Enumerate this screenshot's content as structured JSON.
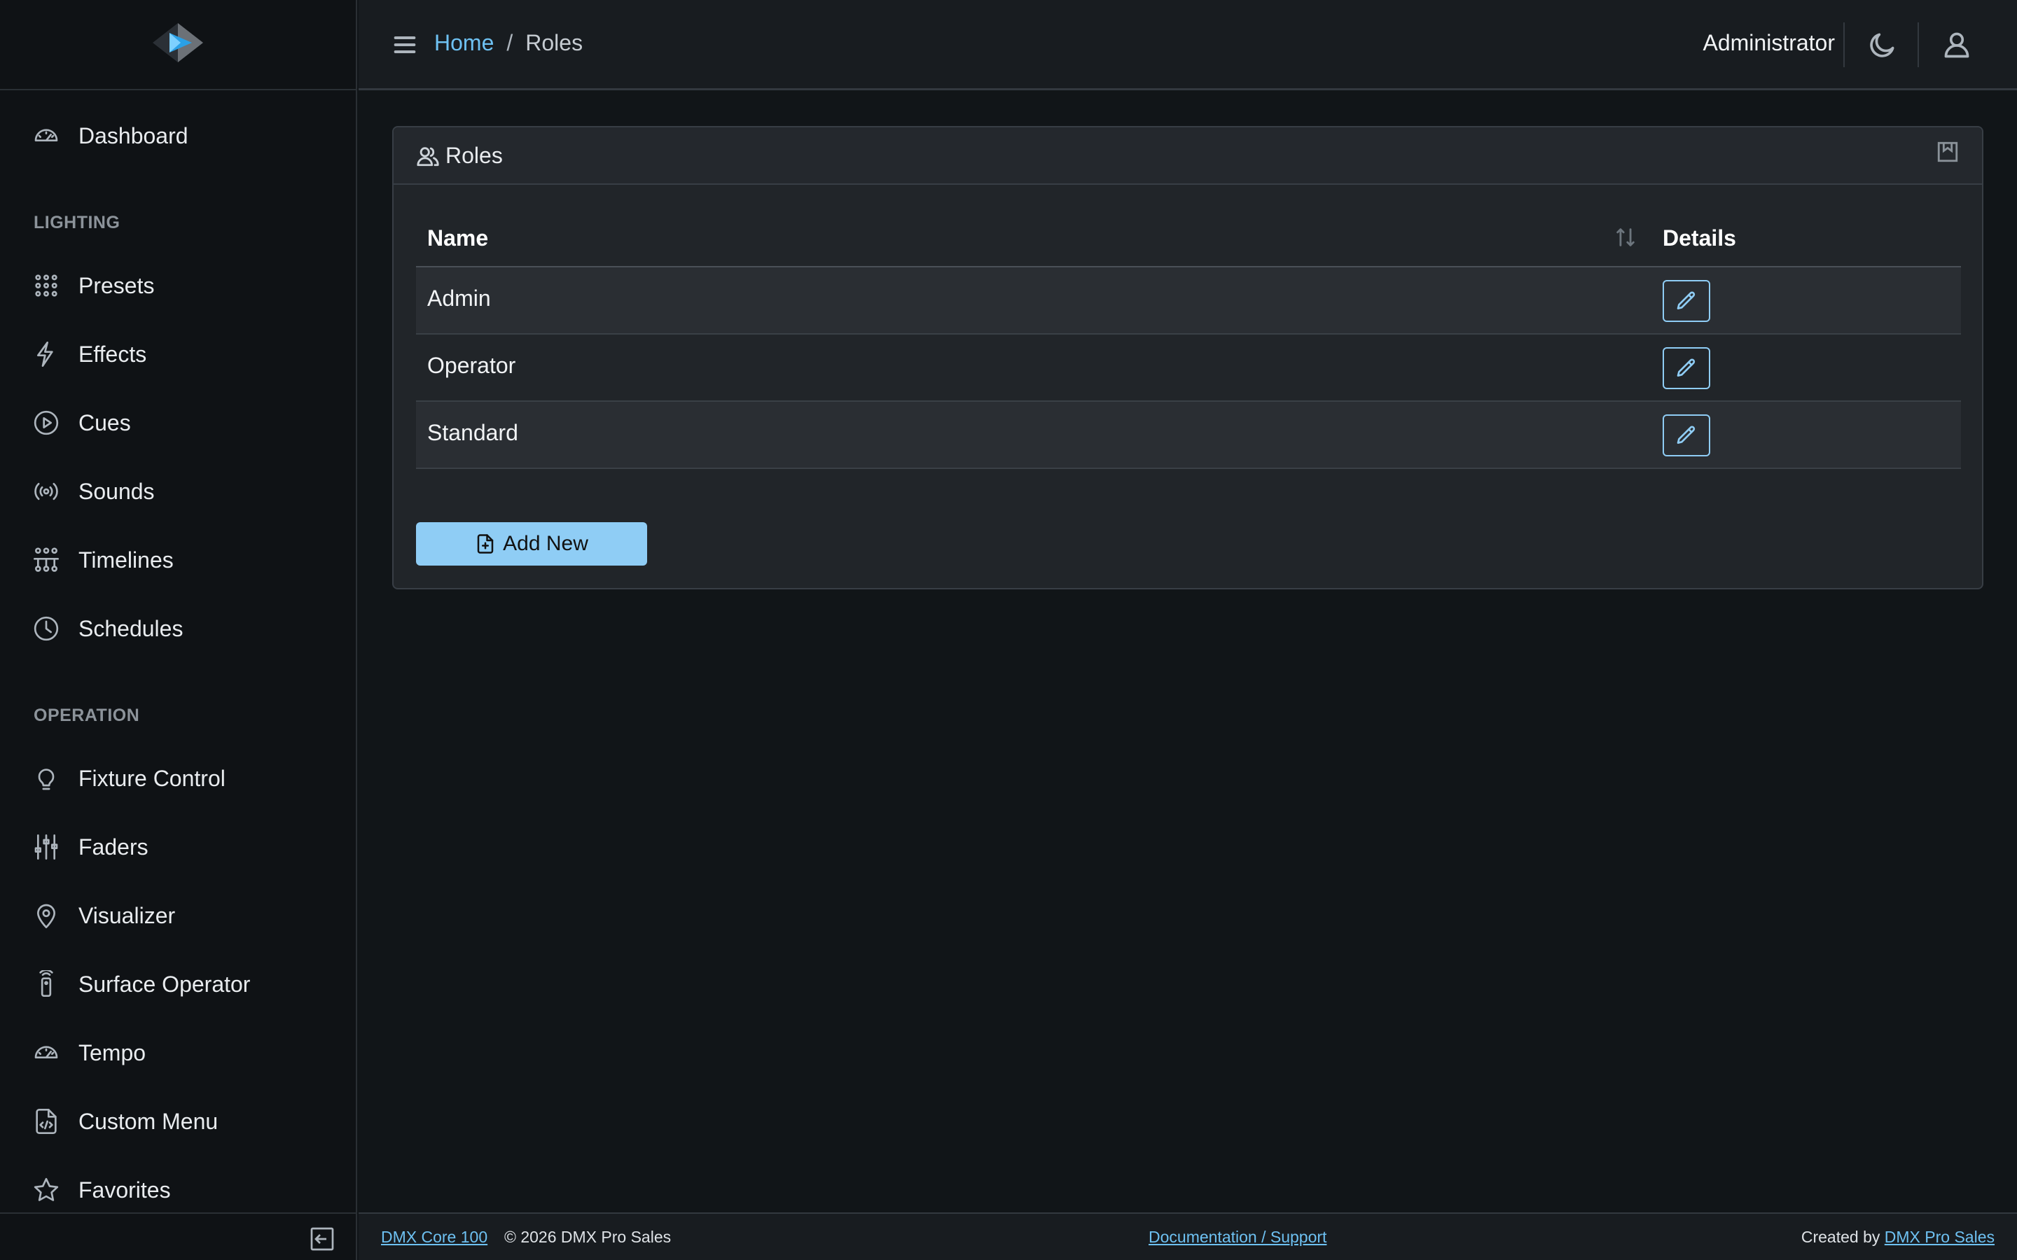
{
  "header": {
    "breadcrumb_home": "Home",
    "breadcrumb_sep": "/",
    "breadcrumb_current": "Roles",
    "user_name": "Administrator"
  },
  "sidebar": {
    "items": [
      {
        "label": "Dashboard",
        "icon": "speedometer-icon"
      },
      {
        "label": "Presets",
        "icon": "grid-dots-icon"
      },
      {
        "label": "Effects",
        "icon": "lightning-icon"
      },
      {
        "label": "Cues",
        "icon": "play-circle-icon"
      },
      {
        "label": "Sounds",
        "icon": "broadcast-icon"
      },
      {
        "label": "Timelines",
        "icon": "diagram-icon"
      },
      {
        "label": "Schedules",
        "icon": "clock-icon"
      },
      {
        "label": "Fixture Control",
        "icon": "lightbulb-icon"
      },
      {
        "label": "Faders",
        "icon": "sliders-icon"
      },
      {
        "label": "Visualizer",
        "icon": "geo-pin-icon"
      },
      {
        "label": "Surface Operator",
        "icon": "remote-icon"
      },
      {
        "label": "Tempo",
        "icon": "speedometer-icon"
      },
      {
        "label": "Custom Menu",
        "icon": "file-code-icon"
      },
      {
        "label": "Favorites",
        "icon": "star-icon"
      }
    ],
    "sections": {
      "lighting": "LIGHTING",
      "operation": "OPERATION"
    }
  },
  "card": {
    "title": "Roles",
    "columns": {
      "name": "Name",
      "details": "Details"
    },
    "rows": [
      {
        "name": "Admin"
      },
      {
        "name": "Operator"
      },
      {
        "name": "Standard"
      }
    ],
    "add_button": "Add New"
  },
  "footer": {
    "product_link": "DMX Core 100",
    "copyright": "© 2026 DMX Pro Sales",
    "docs_link": "Documentation / Support",
    "created_by": "Created by",
    "creator_link": "DMX Pro Sales"
  },
  "colors": {
    "accent": "#8fcdf5",
    "link": "#6ec1f2",
    "background": "#111518",
    "sidebar": "#0f1215"
  }
}
